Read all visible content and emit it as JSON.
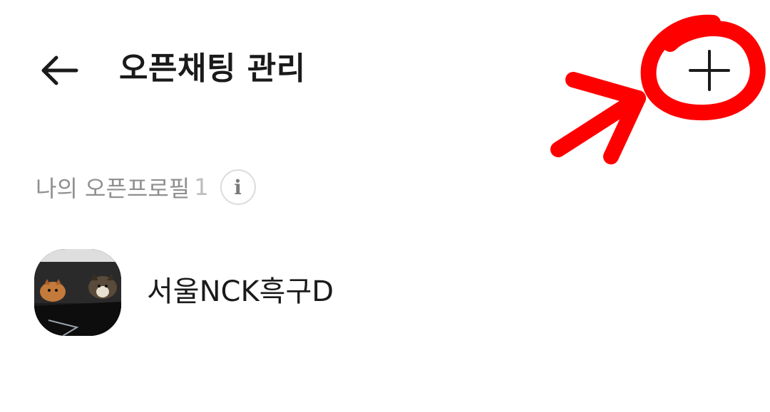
{
  "header": {
    "title": "오픈채팅 관리",
    "back_icon": "arrow-left-icon",
    "add_icon": "plus-icon"
  },
  "section": {
    "label": "나의 오픈프로필",
    "count": "1",
    "info_glyph": "i"
  },
  "profiles": [
    {
      "name": "서울NCK흑구D",
      "avatar": "dog-photo-avatar"
    }
  ],
  "colors": {
    "annotation": "#ff0000",
    "title_text": "#1a1a1a",
    "section_text": "#8f8f8f"
  }
}
